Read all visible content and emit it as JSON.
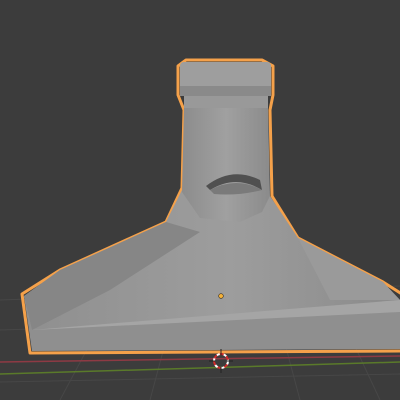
{
  "viewport": {
    "background": "#3c3c3c",
    "grid_line_color": "#464646",
    "x_axis_color": "#9c3a45",
    "y_axis_color": "#5f7d2c"
  },
  "object": {
    "name": "",
    "selected": true,
    "surface_color": "#9a9a9a",
    "outline_color": "#f5a14a",
    "origin_color": "#f5b23a"
  },
  "icons": {
    "cursor": "3d-cursor-icon",
    "origin": "object-origin-icon"
  }
}
